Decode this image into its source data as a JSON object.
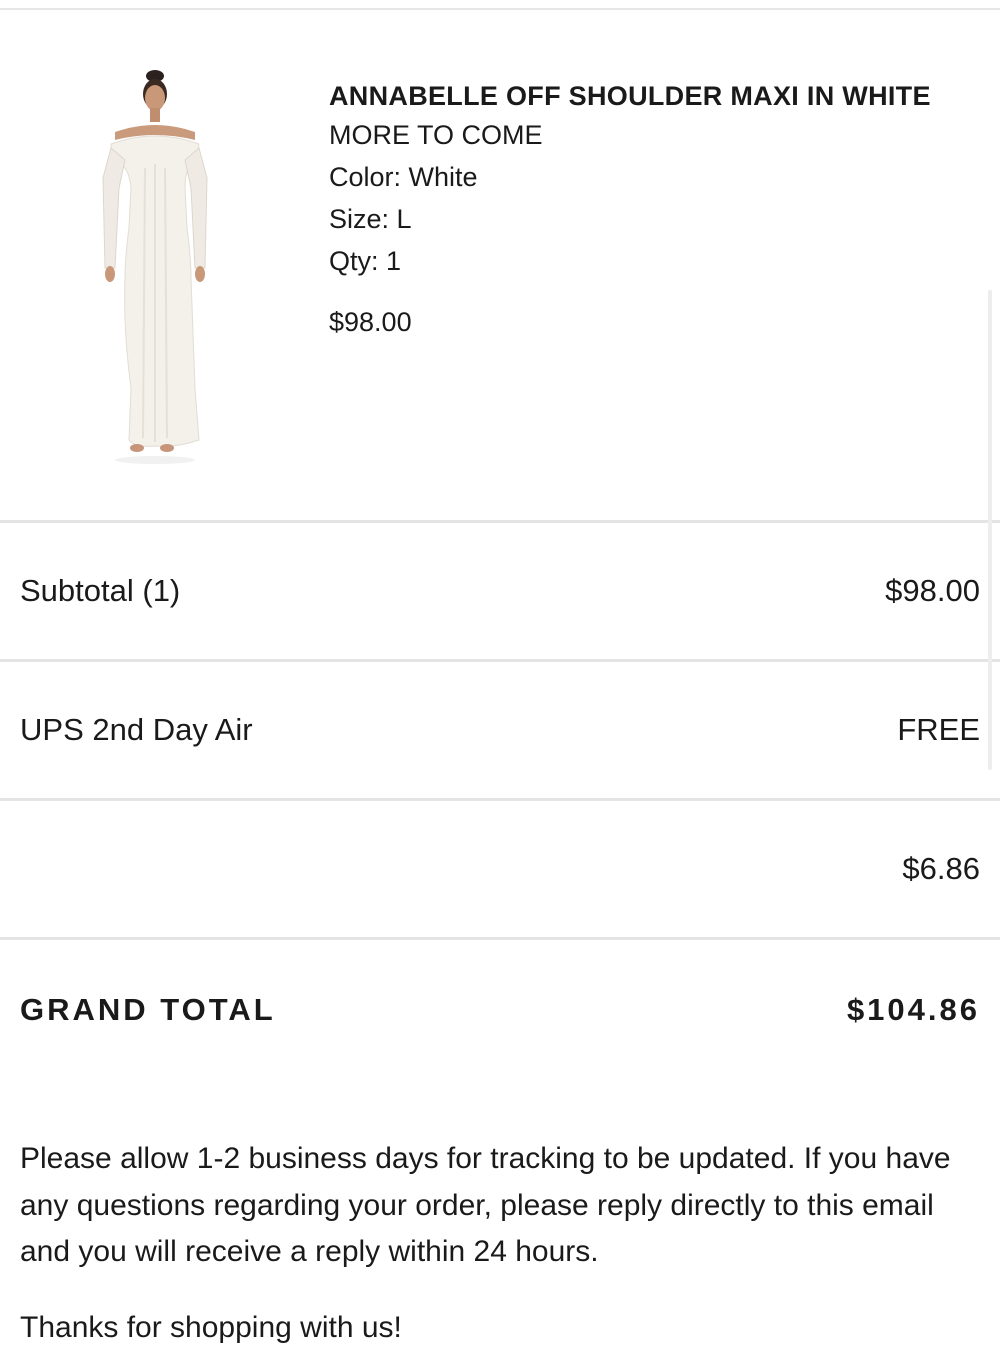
{
  "product": {
    "name": "ANNABELLE OFF SHOULDER MAXI IN WHITE",
    "brand": "MORE TO COME",
    "color": "Color: White",
    "size": "Size: L",
    "qty": "Qty: 1",
    "price": "$98.00"
  },
  "summary": {
    "subtotal_label": "Subtotal (1)",
    "subtotal_value": "$98.00",
    "shipping_label": "UPS 2nd Day Air",
    "shipping_value": "FREE",
    "tax_label": "",
    "tax_value": "$6.86",
    "grand_total_label": "GRAND TOTAL",
    "grand_total_value": "$104.86"
  },
  "message": {
    "note": "Please allow 1-2 business days for tracking to be updated. If you have any questions regarding your order, please reply directly to this email and you will receive a reply within 24 hours.",
    "thanks": "Thanks for shopping with us!"
  }
}
